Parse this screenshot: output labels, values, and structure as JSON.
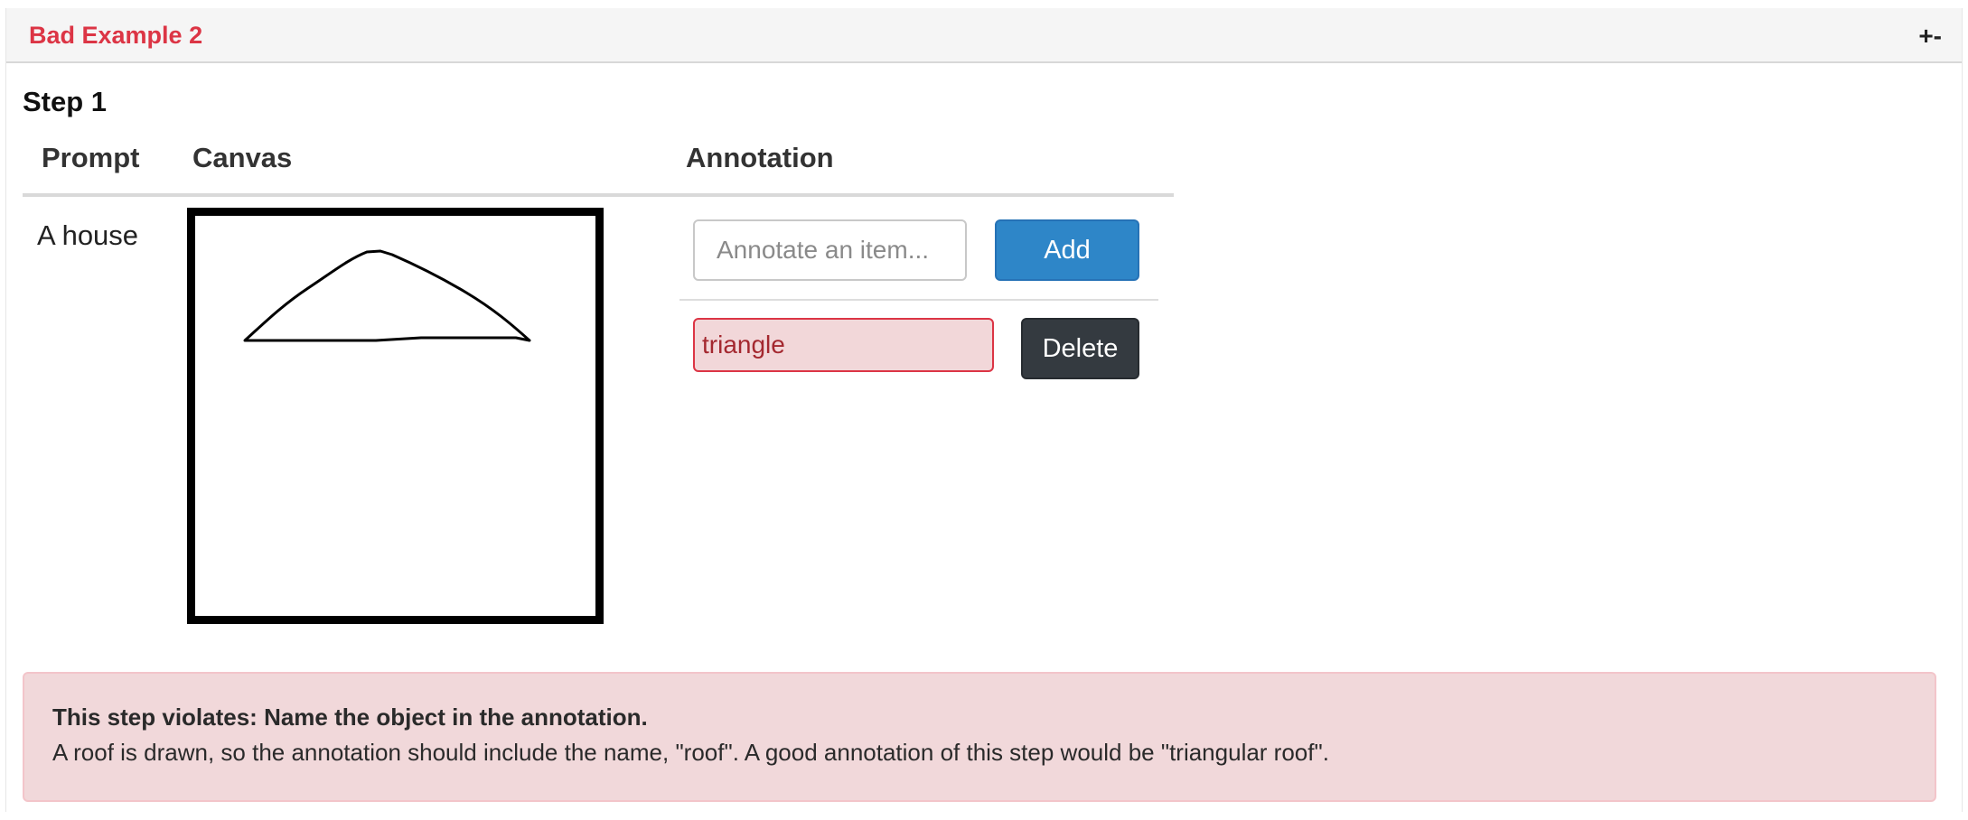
{
  "panel": {
    "title": "Bad Example 2",
    "toggle_label": "+-"
  },
  "step": {
    "title": "Step 1"
  },
  "table": {
    "headers": [
      "Prompt",
      "Canvas",
      "Annotation"
    ],
    "prompt": "A house"
  },
  "canvas": {
    "drawing": "roof-sketch"
  },
  "annotation": {
    "input_placeholder": "Annotate an item...",
    "input_value": "",
    "add_label": "Add",
    "items": [
      {
        "value": "triangle",
        "delete_label": "Delete"
      }
    ]
  },
  "feedback": {
    "heading": "This step violates: Name the object in the annotation.",
    "body": "A roof is drawn, so the annotation should include the name, \"roof\". A good annotation of this step would be \"triangular roof\"."
  },
  "colors": {
    "title_red": "#dc3545",
    "primary_blue": "#2e86c8",
    "dark_button": "#343a40",
    "error_fill": "#f2d7d9",
    "alert_fill": "#f1d8da"
  }
}
